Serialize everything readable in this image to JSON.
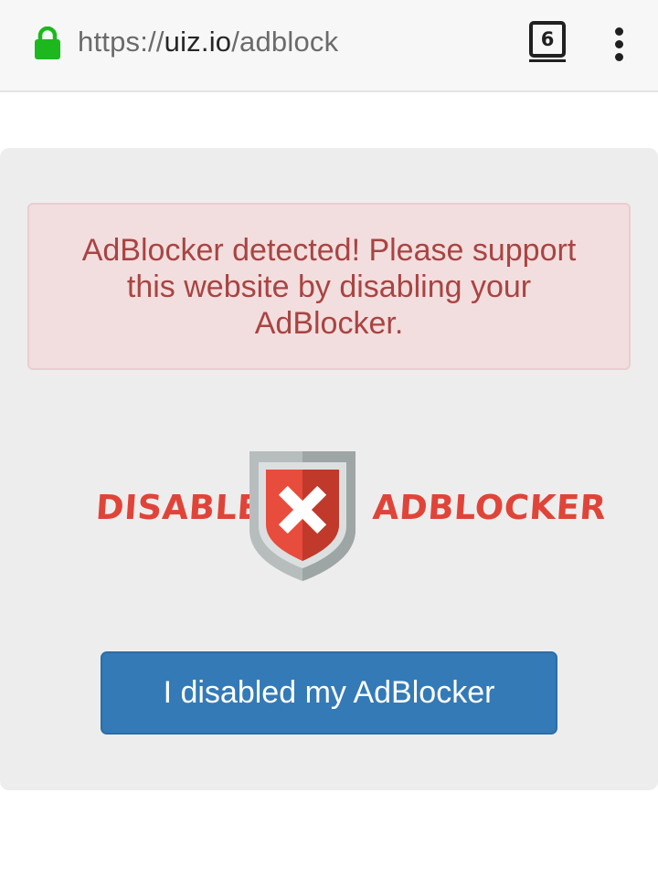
{
  "browser": {
    "url_scheme": "https://",
    "url_host": "uiz.io",
    "url_path": "/adblock",
    "tab_count": "6",
    "lock_color": "#1db81d"
  },
  "alert": {
    "message": "AdBlocker detected! Please support this website by disabling your AdBlocker."
  },
  "banner": {
    "left_word": "DISABLE",
    "right_word": "ADBLOCKER",
    "icon": "shield-x-icon"
  },
  "actions": {
    "confirm_label": "I disabled my AdBlocker"
  },
  "colors": {
    "alert_bg": "#f2dede",
    "alert_text": "#a94442",
    "button_bg": "#337ab7",
    "banner_red": "#e04438"
  }
}
